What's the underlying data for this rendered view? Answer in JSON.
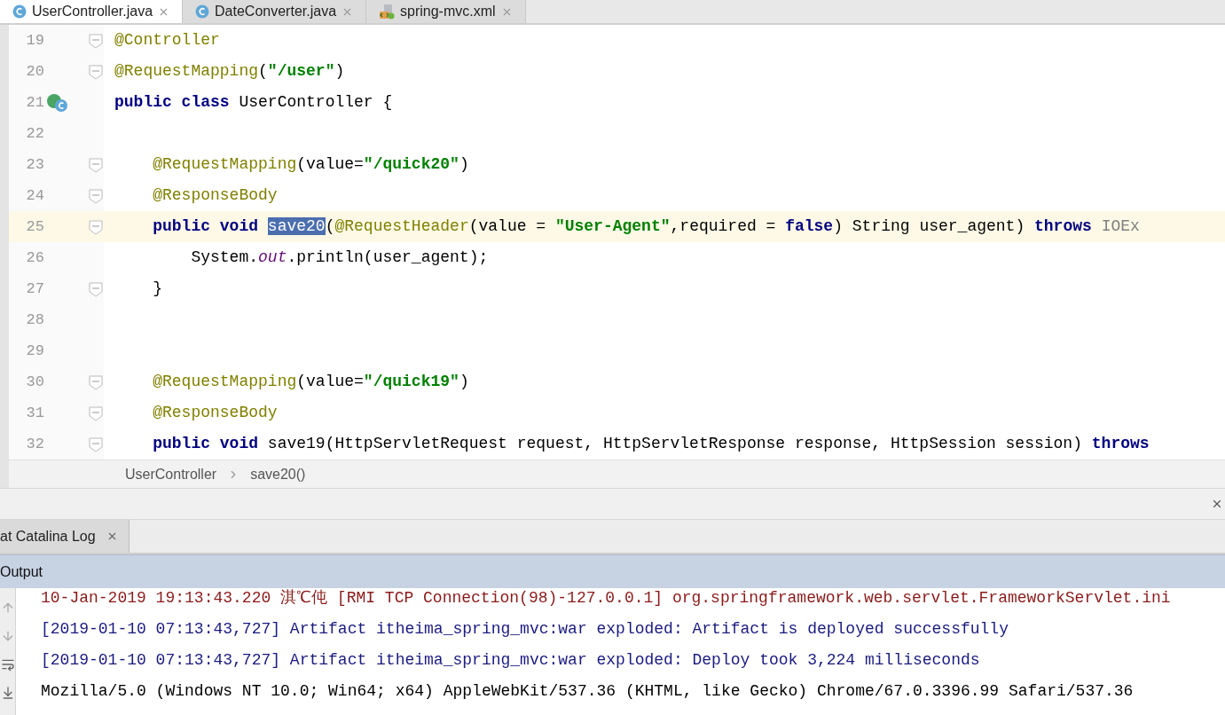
{
  "tabs": [
    {
      "label": "UserController.java",
      "kind": "class",
      "selected": true
    },
    {
      "label": "DateConverter.java",
      "kind": "class",
      "selected": false
    },
    {
      "label": "spring-mvc.xml",
      "kind": "xml",
      "selected": false
    }
  ],
  "editor": {
    "lines": [
      {
        "number": "19",
        "fold": true,
        "gutter_icon": false,
        "current": false,
        "tokens": [
          {
            "kind": "annotation",
            "text": "@Controller"
          }
        ]
      },
      {
        "number": "20",
        "fold": true,
        "gutter_icon": false,
        "current": false,
        "tokens": [
          {
            "kind": "annotation",
            "text": "@RequestMapping"
          },
          {
            "kind": "plain",
            "text": "("
          },
          {
            "kind": "string",
            "text": "\"/user\""
          },
          {
            "kind": "plain",
            "text": ")"
          }
        ]
      },
      {
        "number": "21",
        "fold": false,
        "gutter_icon": true,
        "current": false,
        "tokens": [
          {
            "kind": "keyword",
            "text": "public class "
          },
          {
            "kind": "plain",
            "text": "UserController {"
          }
        ]
      },
      {
        "number": "22",
        "fold": false,
        "gutter_icon": false,
        "current": false
      },
      {
        "number": "23",
        "fold": true,
        "gutter_icon": false,
        "current": false,
        "tokens": [
          {
            "kind": "annotation",
            "text": "    @RequestMapping"
          },
          {
            "kind": "plain",
            "text": "(value="
          },
          {
            "kind": "string",
            "text": "\"/quick20\""
          },
          {
            "kind": "plain",
            "text": ")"
          }
        ]
      },
      {
        "number": "24",
        "fold": true,
        "gutter_icon": false,
        "current": false,
        "tokens": [
          {
            "kind": "annotation",
            "text": "    @ResponseBody"
          }
        ]
      },
      {
        "number": "25",
        "fold": true,
        "gutter_icon": false,
        "current": true,
        "tokens": [
          {
            "kind": "keyword",
            "text": "    public void "
          },
          {
            "kind": "selection",
            "text": "save20"
          },
          {
            "kind": "plain",
            "text": "("
          },
          {
            "kind": "annotation",
            "text": "@RequestHeader"
          },
          {
            "kind": "plain",
            "text": "(value = "
          },
          {
            "kind": "string",
            "text": "\"User-Agent\""
          },
          {
            "kind": "plain",
            "text": ",required = "
          },
          {
            "kind": "keyword",
            "text": "false"
          },
          {
            "kind": "plain",
            "text": ") String user_agent) "
          },
          {
            "kind": "keyword",
            "text": "throws "
          },
          {
            "kind": "unresolved",
            "text": "IOEx"
          }
        ]
      },
      {
        "number": "26",
        "fold": false,
        "gutter_icon": false,
        "current": false,
        "tokens": [
          {
            "kind": "plain",
            "text": "        System."
          },
          {
            "kind": "static",
            "text": "out"
          },
          {
            "kind": "plain",
            "text": ".println(user_agent);"
          }
        ]
      },
      {
        "number": "27",
        "fold": true,
        "gutter_icon": false,
        "current": false,
        "tokens": [
          {
            "kind": "plain",
            "text": "    }"
          }
        ]
      },
      {
        "number": "28",
        "fold": false,
        "gutter_icon": false,
        "current": false
      },
      {
        "number": "29",
        "fold": false,
        "gutter_icon": false,
        "current": false
      },
      {
        "number": "30",
        "fold": true,
        "gutter_icon": false,
        "current": false,
        "tokens": [
          {
            "kind": "annotation",
            "text": "    @RequestMapping"
          },
          {
            "kind": "plain",
            "text": "(value="
          },
          {
            "kind": "string",
            "text": "\"/quick19\""
          },
          {
            "kind": "plain",
            "text": ")"
          }
        ]
      },
      {
        "number": "31",
        "fold": true,
        "gutter_icon": false,
        "current": false,
        "tokens": [
          {
            "kind": "annotation",
            "text": "    @ResponseBody"
          }
        ]
      },
      {
        "number": "32",
        "fold": true,
        "gutter_icon": false,
        "current": false,
        "tokens": [
          {
            "kind": "keyword",
            "text": "    public void "
          },
          {
            "kind": "plain",
            "text": "save19(HttpServletRequest request, HttpServletResponse response, HttpSession session) "
          },
          {
            "kind": "keyword",
            "text": "throws"
          }
        ]
      }
    ]
  },
  "breadcrumb": [
    "UserController",
    "save20()"
  ],
  "tool_window": {
    "tab": {
      "label": "at Catalina Log",
      "selected": true
    },
    "header": "Output",
    "log": [
      {
        "kind": "error",
        "text": "10-Jan-2019 19:13:43.220 淇℃伅 [RMI TCP Connection(98)-127.0.0.1] org.springframework.web.servlet.FrameworkServlet.ini"
      },
      {
        "kind": "info",
        "text": "[2019-01-10 07:13:43,727] Artifact itheima_spring_mvc:war exploded: Artifact is deployed successfully"
      },
      {
        "kind": "info",
        "text": "[2019-01-10 07:13:43,727] Artifact itheima_spring_mvc:war exploded: Deploy took 3,224 milliseconds"
      },
      {
        "kind": "plain",
        "text": "Mozilla/5.0 (Windows NT 10.0; Win64; x64) AppleWebKit/537.36 (KHTML, like Gecko) Chrome/67.0.3396.99 Safari/537.36"
      }
    ]
  }
}
